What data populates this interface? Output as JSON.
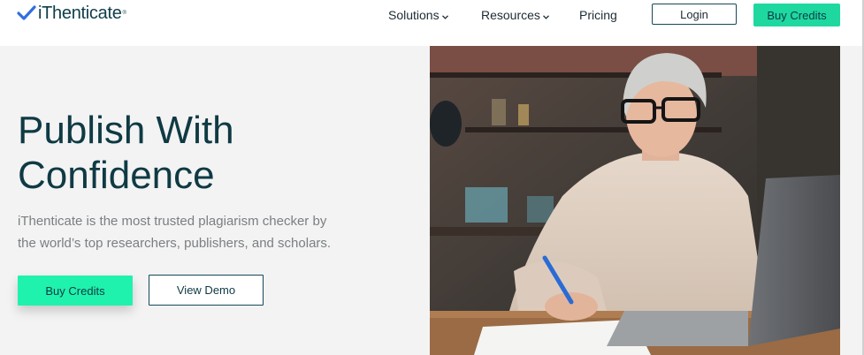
{
  "brand": {
    "name": "iThenticate",
    "reg_mark": "®"
  },
  "nav": {
    "solutions": "Solutions",
    "resources": "Resources",
    "pricing": "Pricing",
    "login": "Login",
    "buy_credits": "Buy Credits"
  },
  "hero": {
    "title_line1": "Publish With",
    "title_line2": "Confidence",
    "subtitle_line1": "iThenticate is the most trusted plagiarism checker by",
    "subtitle_line2": "the world’s top researchers, publishers, and scholars.",
    "primary_button": "Buy Credits",
    "secondary_button": "View Demo"
  },
  "colors": {
    "brand_teal": "#0f3a44",
    "accent_green": "#1ff2ad",
    "check_blue": "#2f6fe0"
  },
  "icons": {
    "logo": "checkmark-icon",
    "dropdown": "chevron-down-icon"
  }
}
